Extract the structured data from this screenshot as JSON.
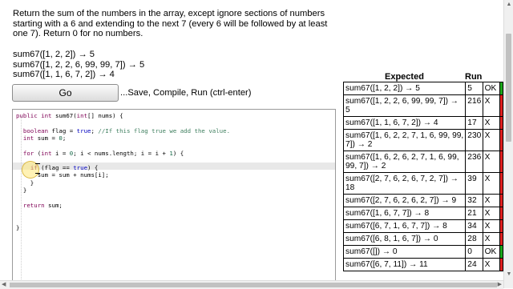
{
  "problem": {
    "description": "Return the sum of the numbers in the array, except ignore sections of numbers starting with a 6 and extending to the next 7 (every 6 will be followed by at least one 7). Return 0 for no numbers.",
    "examples": [
      "sum67([1, 2, 2]) → 5",
      "sum67([1, 2, 2, 6, 99, 99, 7]) → 5",
      "sum67([1, 1, 6, 7, 2]) → 4"
    ]
  },
  "toolbar": {
    "go_label": "Go",
    "go_hint": "...Save, Compile, Run (ctrl-enter)"
  },
  "code": {
    "lines": [
      "public int sum67(int[] nums) {",
      "",
      "  boolean flag = true; //If this flag true we add the value.",
      "  int sum = 0;",
      "",
      "  for (int i = 0; i < nums.length; i = i + 1) {",
      "",
      "    if (flag == true) {",
      "      sum = sum + nums[i];",
      "    }",
      "  }",
      "",
      "  return sum;",
      "",
      "",
      "}"
    ]
  },
  "results": {
    "header_expected": "Expected",
    "header_run": "Run",
    "rows": [
      {
        "expected": "sum67([1, 2, 2]) → 5",
        "run": "5",
        "status": "OK"
      },
      {
        "expected": "sum67([1, 2, 2, 6, 99, 99, 7]) → 5",
        "run": "216",
        "status": "X"
      },
      {
        "expected": "sum67([1, 1, 6, 7, 2]) → 4",
        "run": "17",
        "status": "X"
      },
      {
        "expected": "sum67([1, 6, 2, 2, 7, 1, 6, 99, 99, 7]) → 2",
        "run": "230",
        "status": "X"
      },
      {
        "expected": "sum67([1, 6, 2, 6, 2, 7, 1, 6, 99, 99, 7]) → 2",
        "run": "236",
        "status": "X"
      },
      {
        "expected": "sum67([2, 7, 6, 2, 6, 7, 2, 7]) → 18",
        "run": "39",
        "status": "X"
      },
      {
        "expected": "sum67([2, 7, 6, 2, 6, 2, 7]) → 9",
        "run": "32",
        "status": "X"
      },
      {
        "expected": "sum67([1, 6, 7, 7]) → 8",
        "run": "21",
        "status": "X"
      },
      {
        "expected": "sum67([6, 7, 1, 6, 7, 7]) → 8",
        "run": "34",
        "status": "X"
      },
      {
        "expected": "sum67([6, 8, 1, 6, 7]) → 0",
        "run": "28",
        "status": "X"
      },
      {
        "expected": "sum67([]) → 0",
        "run": "0",
        "status": "OK"
      },
      {
        "expected": "sum67([6, 7, 11]) → 11",
        "run": "24",
        "status": "X"
      }
    ]
  },
  "colors": {
    "ok": "#1aa81a",
    "fail": "#e02020",
    "keyword": "#7f0055",
    "comment": "#3f7f5f"
  }
}
